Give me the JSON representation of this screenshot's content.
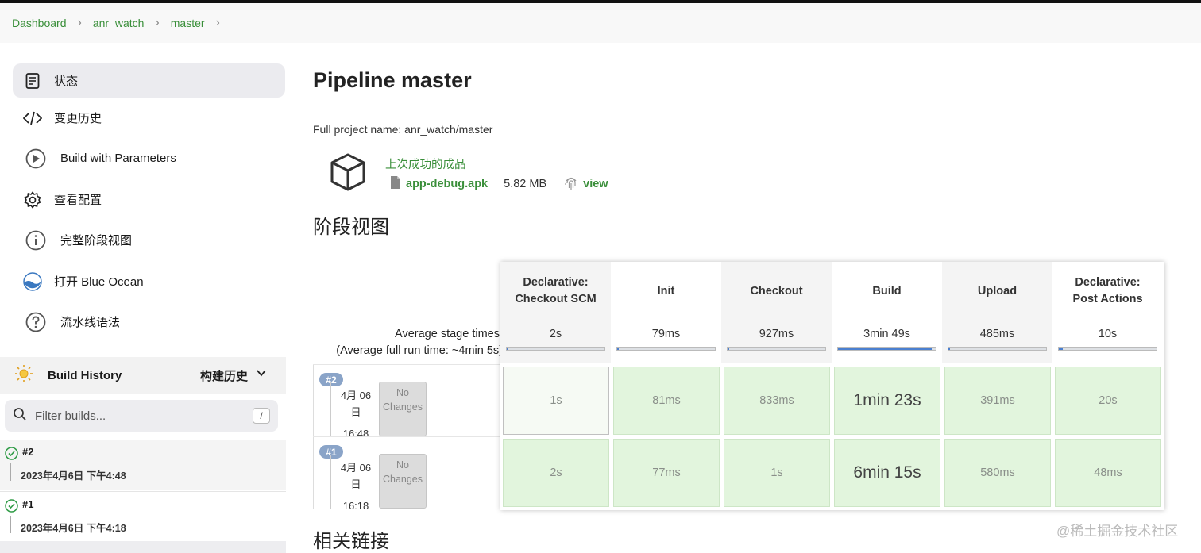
{
  "breadcrumb": {
    "items": [
      "Dashboard",
      "anr_watch",
      "master"
    ]
  },
  "sidebar": {
    "items": [
      {
        "label": "状态",
        "icon": "document-icon"
      },
      {
        "label": "变更历史",
        "icon": "code-icon"
      },
      {
        "label": "Build with Parameters",
        "icon": "play-icon"
      },
      {
        "label": "查看配置",
        "icon": "gear-icon"
      },
      {
        "label": "完整阶段视图",
        "icon": "info-icon"
      },
      {
        "label": "打开 Blue Ocean",
        "icon": "blue-ocean-icon"
      },
      {
        "label": "流水线语法",
        "icon": "help-icon"
      }
    ],
    "build_history": {
      "title": "Build History",
      "title_cn": "构建历史",
      "filter_placeholder": "Filter builds...",
      "filter_shortcut": "/",
      "builds": [
        {
          "number": "#2",
          "date": "2023年4月6日 下午4:48"
        },
        {
          "number": "#1",
          "date": "2023年4月6日 下午4:18"
        }
      ]
    }
  },
  "main": {
    "title": "Pipeline master",
    "full_name": "Full project name: anr_watch/master",
    "artifacts": {
      "title": "上次成功的成品",
      "file": "app-debug.apk",
      "size": "5.82 MB",
      "view": "view"
    },
    "stage_view_title": "阶段视图",
    "related_links_title": "相关链接",
    "avg_stage_label": "Average stage times:",
    "avg_run_prefix": "(Average ",
    "avg_run_link": "full",
    "avg_run_suffix": " run time: ~4min 5s)",
    "stages": [
      {
        "name1": "Declarative:",
        "name2": "Checkout SCM",
        "avg": "2s",
        "fill": 0.02
      },
      {
        "name1": "Init",
        "name2": "",
        "avg": "79ms",
        "fill": 0.01
      },
      {
        "name1": "Checkout",
        "name2": "",
        "avg": "927ms",
        "fill": 0.01
      },
      {
        "name1": "Build",
        "name2": "",
        "avg": "3min 49s",
        "fill": 0.96
      },
      {
        "name1": "Upload",
        "name2": "",
        "avg": "485ms",
        "fill": 0.01
      },
      {
        "name1": "Declarative:",
        "name2": "Post Actions",
        "avg": "10s",
        "fill": 0.04
      }
    ],
    "runs": [
      {
        "badge": "#2",
        "date1": "4月 06",
        "date2": "日",
        "time": "16:48",
        "changes1": "No",
        "changes2": "Changes",
        "cells": [
          "1s",
          "81ms",
          "833ms",
          "1min 23s",
          "391ms",
          "20s"
        ]
      },
      {
        "badge": "#1",
        "date1": "4月 06",
        "date2": "日",
        "time": "16:18",
        "changes1": "No",
        "changes2": "Changes",
        "cells": [
          "2s",
          "77ms",
          "1s",
          "6min 15s",
          "580ms",
          "48ms"
        ]
      }
    ]
  },
  "watermark": "@稀土掘金技术社区"
}
